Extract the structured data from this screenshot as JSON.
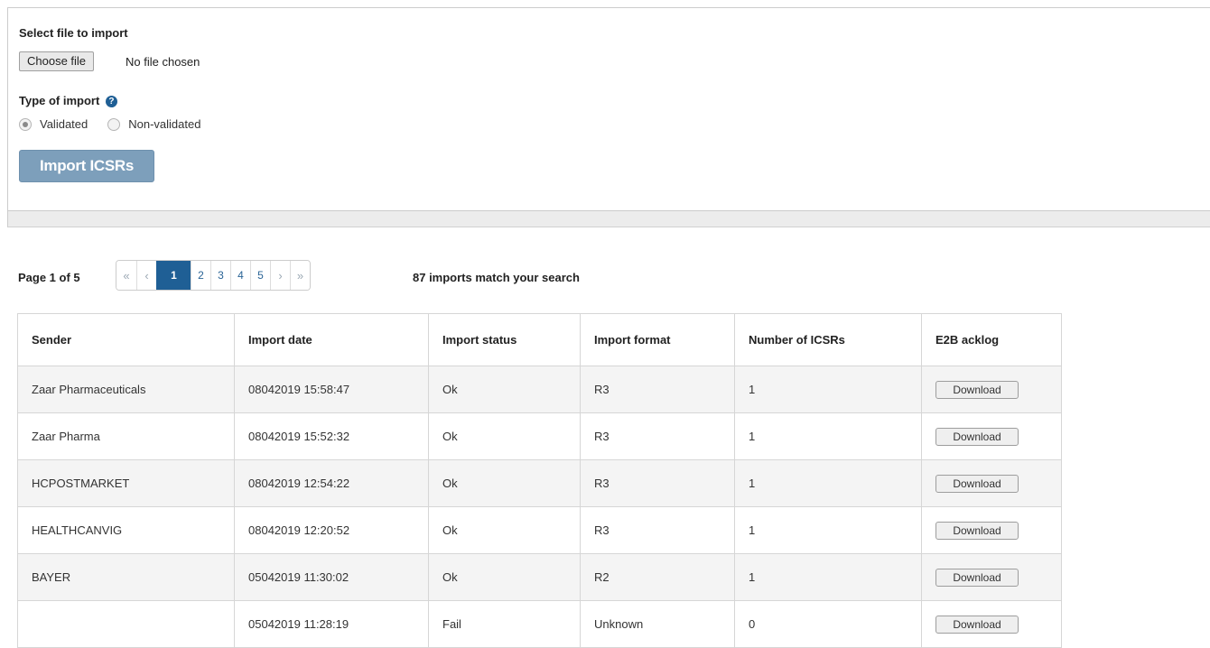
{
  "import_form": {
    "file_label": "Select file to import",
    "choose_button": "Choose file",
    "file_status": "No file chosen",
    "type_label": "Type of import",
    "help_icon": "question-circle-icon",
    "options": [
      {
        "label": "Validated",
        "selected": true
      },
      {
        "label": "Non-validated",
        "selected": false
      }
    ],
    "submit_button": "Import ICSRs"
  },
  "pager": {
    "page_label": "Page 1 of 5",
    "first": "«",
    "prev": "‹",
    "pages": [
      "1",
      "2",
      "3",
      "4",
      "5"
    ],
    "current_page": "1",
    "next": "›",
    "last": "»",
    "match_text": "87 imports match your search"
  },
  "table": {
    "columns": [
      "Sender",
      "Import date",
      "Import status",
      "Import format",
      "Number of ICSRs",
      "E2B acklog"
    ],
    "rows": [
      {
        "sender": "Zaar Pharmaceuticals",
        "date": "08042019 15:58:47",
        "status": "Ok",
        "format": "R3",
        "count": "1",
        "action": "Download"
      },
      {
        "sender": "Zaar Pharma",
        "date": "08042019 15:52:32",
        "status": "Ok",
        "format": "R3",
        "count": "1",
        "action": "Download"
      },
      {
        "sender": "HCPOSTMARKET",
        "date": "08042019 12:54:22",
        "status": "Ok",
        "format": "R3",
        "count": "1",
        "action": "Download"
      },
      {
        "sender": "HEALTHCANVIG",
        "date": "08042019 12:20:52",
        "status": "Ok",
        "format": "R3",
        "count": "1",
        "action": "Download"
      },
      {
        "sender": "BAYER",
        "date": "05042019 11:30:02",
        "status": "Ok",
        "format": "R2",
        "count": "1",
        "action": "Download"
      },
      {
        "sender": "",
        "date": "05042019 11:28:19",
        "status": "Fail",
        "format": "Unknown",
        "count": "0",
        "action": "Download"
      }
    ]
  },
  "colors": {
    "primary": "#1f5f95",
    "import_button": "#7d9fbb",
    "row_stripe": "#f4f4f4"
  }
}
